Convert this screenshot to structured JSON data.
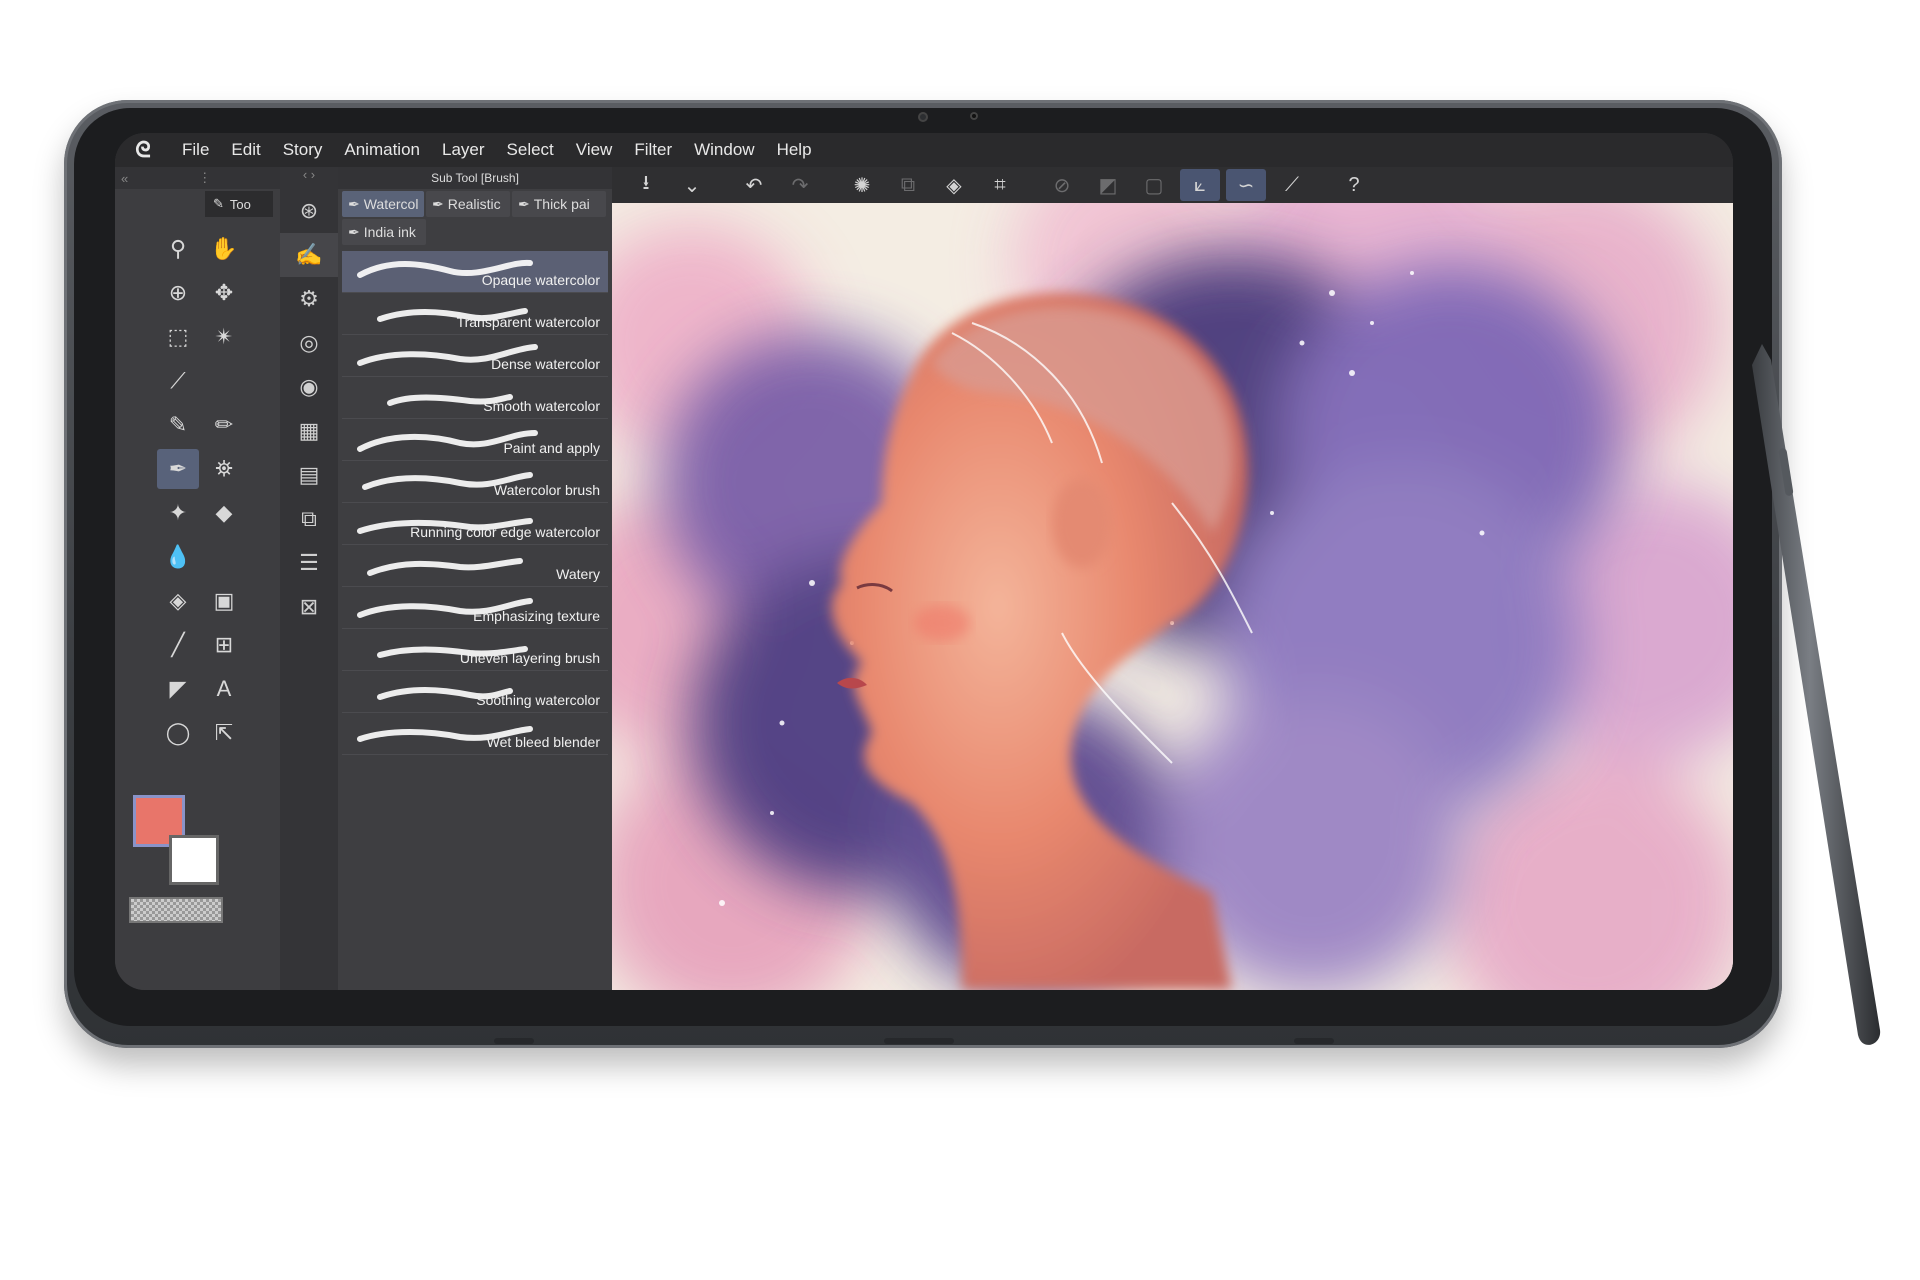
{
  "app": {
    "menu": [
      "File",
      "Edit",
      "Story",
      "Animation",
      "Layer",
      "Select",
      "View",
      "Filter",
      "Window",
      "Help"
    ]
  },
  "tool_panel": {
    "tab_label": "Too"
  },
  "sub_tool_panel": {
    "title": "Sub Tool [Brush]",
    "groups": [
      {
        "label": "Watercol",
        "active": true
      },
      {
        "label": "Realistic",
        "active": false
      },
      {
        "label": "Thick pai",
        "active": false
      },
      {
        "label": "India ink",
        "active": false
      }
    ],
    "brushes": [
      {
        "name": "Opaque watercolor",
        "selected": true
      },
      {
        "name": "Transparent watercolor",
        "selected": false
      },
      {
        "name": "Dense watercolor",
        "selected": false
      },
      {
        "name": "Smooth watercolor",
        "selected": false
      },
      {
        "name": "Paint and apply",
        "selected": false
      },
      {
        "name": "Watercolor brush",
        "selected": false
      },
      {
        "name": "Running color edge watercolor",
        "selected": false
      },
      {
        "name": "Watery",
        "selected": false
      },
      {
        "name": "Emphasizing texture",
        "selected": false
      },
      {
        "name": "Uneven layering brush",
        "selected": false
      },
      {
        "name": "Soothing watercolor",
        "selected": false
      },
      {
        "name": "Wet bleed blender",
        "selected": false
      }
    ]
  },
  "colors": {
    "main_color": "#e8756a",
    "sub_color": "#ffffff",
    "accent": "#5a6378"
  },
  "command_bar": [
    {
      "icon": "save-icon"
    },
    {
      "icon": "chevron-down-icon"
    },
    {
      "icon": "undo-icon"
    },
    {
      "icon": "redo-icon"
    },
    {
      "icon": "loading-icon"
    },
    {
      "icon": "copy-layer-icon"
    },
    {
      "icon": "fill-icon"
    },
    {
      "icon": "transform-icon"
    },
    {
      "icon": "clear-selection-icon"
    },
    {
      "icon": "invert-selection-icon"
    },
    {
      "icon": "selection-box-icon"
    },
    {
      "icon": "stroke-correction-icon"
    },
    {
      "icon": "smoothing-icon"
    },
    {
      "icon": "pen-pressure-icon"
    },
    {
      "icon": "help-icon"
    }
  ]
}
